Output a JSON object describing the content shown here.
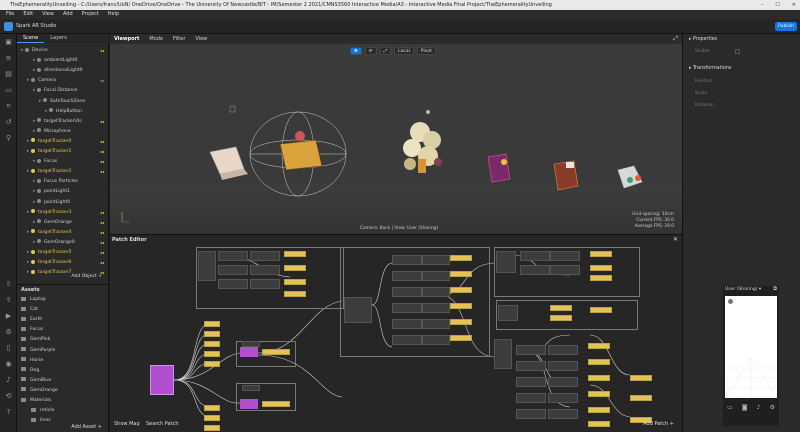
{
  "window": {
    "title": "TheEphemeralityUnveiling - C:/Users/franc/UoN/ OneDrive/OneDrive - The University Of Newcastle/BIT - IM/Semester 2 2021/CMNS3560 Interactive Media/A3 - Interactive Media Final Project/TheEphemeralityUnveiling",
    "minimize": "–",
    "maximize": "☐",
    "close": "✕"
  },
  "menu": [
    "File",
    "Edit",
    "View",
    "Add",
    "Project",
    "Help"
  ],
  "app": {
    "name": "Spark AR Studio",
    "publish": "Publish"
  },
  "scene": {
    "tabs": [
      "Scene",
      "Layers"
    ],
    "items": [
      {
        "label": "Device",
        "indent": 0,
        "yellow": false,
        "flag": "◂◂"
      },
      {
        "label": "ambientLight0",
        "indent": 2,
        "yellow": false,
        "flag": ""
      },
      {
        "label": "directionalLight0",
        "indent": 2,
        "yellow": false,
        "flag": ""
      },
      {
        "label": "Camera",
        "indent": 1,
        "yellow": false,
        "flag": "◂◂"
      },
      {
        "label": "Focal Distance",
        "indent": 2,
        "yellow": false,
        "flag": ""
      },
      {
        "label": "SafeTouchZone",
        "indent": 3,
        "yellow": false,
        "flag": ""
      },
      {
        "label": "HelpButton",
        "indent": 4,
        "yellow": false,
        "flag": ""
      },
      {
        "label": "targetTrackerUIs",
        "indent": 2,
        "yellow": false,
        "flag": "◂◂"
      },
      {
        "label": "Microphone",
        "indent": 2,
        "yellow": false,
        "flag": ""
      },
      {
        "label": "targetTracker0",
        "indent": 1,
        "yellow": true,
        "flag": "◂◂"
      },
      {
        "label": "targetTracker1",
        "indent": 1,
        "yellow": true,
        "flag": "◂◂"
      },
      {
        "label": "Focus",
        "indent": 2,
        "yellow": false,
        "flag": "◂◂"
      },
      {
        "label": "targetTracker2",
        "indent": 1,
        "yellow": true,
        "flag": "◂◂"
      },
      {
        "label": "Focus Particles",
        "indent": 2,
        "yellow": false,
        "flag": ""
      },
      {
        "label": "pointLight1",
        "indent": 2,
        "yellow": false,
        "flag": ""
      },
      {
        "label": "pointLight0",
        "indent": 2,
        "yellow": false,
        "flag": ""
      },
      {
        "label": "targetTracker3",
        "indent": 1,
        "yellow": true,
        "flag": "◂◂"
      },
      {
        "label": "GemOrange",
        "indent": 2,
        "yellow": false,
        "flag": "◂◂"
      },
      {
        "label": "targetTracker4",
        "indent": 1,
        "yellow": true,
        "flag": "◂◂"
      },
      {
        "label": "GemOrange0",
        "indent": 2,
        "yellow": false,
        "flag": "◂◂"
      },
      {
        "label": "targetTracker5",
        "indent": 1,
        "yellow": true,
        "flag": "◂◂"
      },
      {
        "label": "targetTracker6",
        "indent": 1,
        "yellow": true,
        "flag": "◂◂"
      },
      {
        "label": "targetTracker7",
        "indent": 1,
        "yellow": true,
        "flag": "◂◂"
      }
    ],
    "add_object": "Add Object"
  },
  "assets": {
    "title": "Assets",
    "items": [
      "Laptop",
      "Cat",
      "Earth",
      "Focus",
      "GemPink",
      "GemPurple",
      "Horse",
      "Dog",
      "GemBlue",
      "GemOrange",
      "Materials",
      "reticle",
      "lines"
    ],
    "add_asset": "Add Asset"
  },
  "viewport": {
    "tabs": [
      "Viewport",
      "Mode",
      "Filter",
      "View"
    ],
    "tools": [
      "✥",
      "⟳",
      "⤢",
      "Local",
      "Pivot"
    ],
    "camera_label": "Camera: Back | View: User (Sharing)",
    "stats": [
      "Grid spacing: 10cm",
      "Current FPS: 30.0",
      "Average FPS: 29.0"
    ]
  },
  "patch_editor": {
    "title": "Patch Editor",
    "show_map": "Show Map",
    "search_patch": "Search Patch",
    "add_patch": "Add Patch",
    "close": "✕"
  },
  "properties": {
    "title": "Properties",
    "visible": "Visible",
    "transformations": "Transformations",
    "fields": [
      "Position",
      "Scale",
      "Rotation"
    ]
  },
  "preview": {
    "label": "User (Sharing)"
  }
}
